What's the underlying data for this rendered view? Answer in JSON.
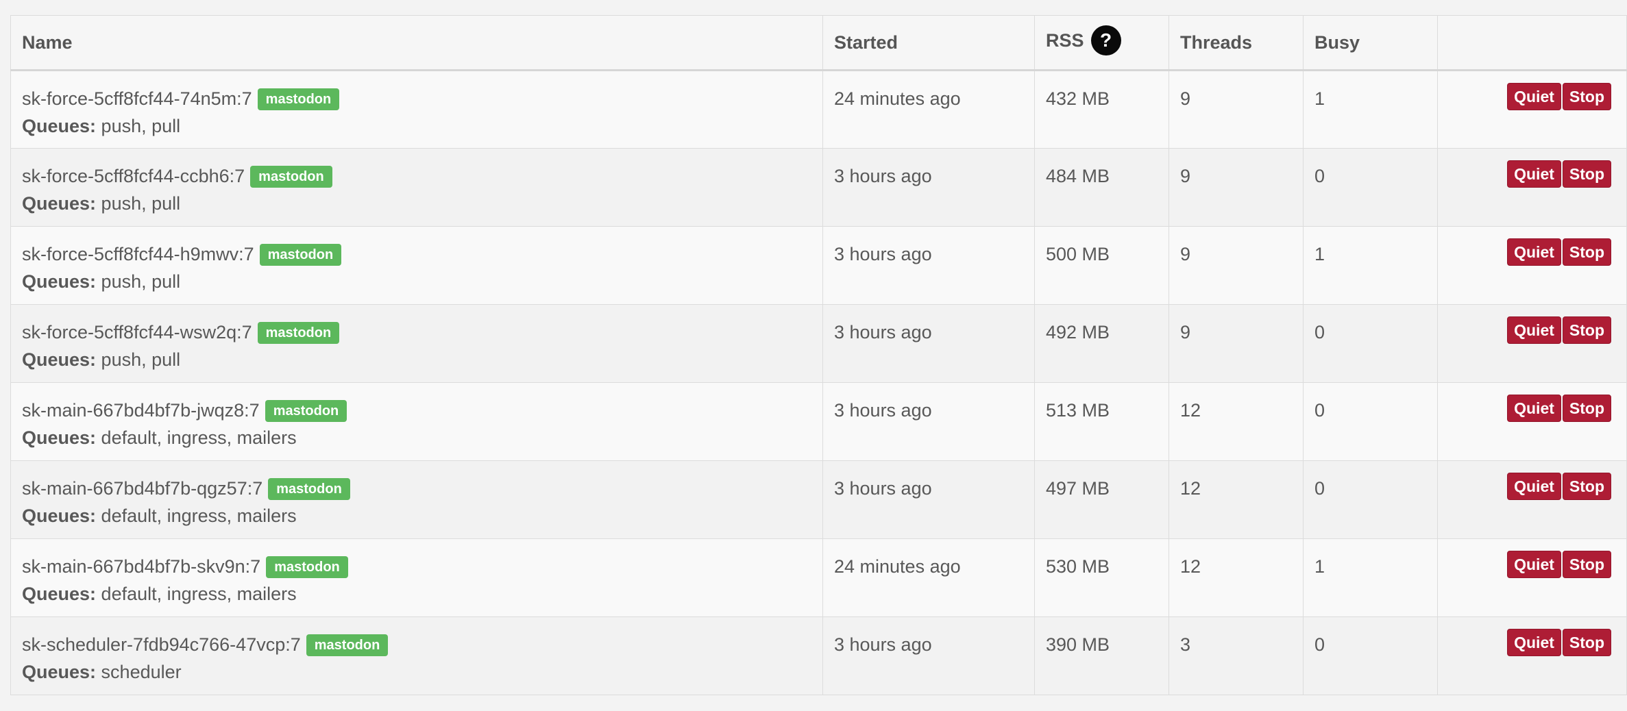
{
  "headers": {
    "name": "Name",
    "started": "Started",
    "rss": "RSS",
    "rss_help": "?",
    "threads": "Threads",
    "busy": "Busy",
    "actions": ""
  },
  "labels": {
    "queues": "Queues:",
    "quiet": "Quiet",
    "stop": "Stop"
  },
  "colors": {
    "tag_green": "#5cb85c",
    "button_red": "#ae1d35"
  },
  "processes": [
    {
      "name": "sk-force-5cff8fcf44-74n5m:7",
      "tag": "mastodon",
      "queues": "push, pull",
      "started": "24 minutes ago",
      "rss": "432 MB",
      "threads": "9",
      "busy": "1"
    },
    {
      "name": "sk-force-5cff8fcf44-ccbh6:7",
      "tag": "mastodon",
      "queues": "push, pull",
      "started": "3 hours ago",
      "rss": "484 MB",
      "threads": "9",
      "busy": "0"
    },
    {
      "name": "sk-force-5cff8fcf44-h9mwv:7",
      "tag": "mastodon",
      "queues": "push, pull",
      "started": "3 hours ago",
      "rss": "500 MB",
      "threads": "9",
      "busy": "1"
    },
    {
      "name": "sk-force-5cff8fcf44-wsw2q:7",
      "tag": "mastodon",
      "queues": "push, pull",
      "started": "3 hours ago",
      "rss": "492 MB",
      "threads": "9",
      "busy": "0"
    },
    {
      "name": "sk-main-667bd4bf7b-jwqz8:7",
      "tag": "mastodon",
      "queues": "default, ingress, mailers",
      "started": "3 hours ago",
      "rss": "513 MB",
      "threads": "12",
      "busy": "0"
    },
    {
      "name": "sk-main-667bd4bf7b-qgz57:7",
      "tag": "mastodon",
      "queues": "default, ingress, mailers",
      "started": "3 hours ago",
      "rss": "497 MB",
      "threads": "12",
      "busy": "0"
    },
    {
      "name": "sk-main-667bd4bf7b-skv9n:7",
      "tag": "mastodon",
      "queues": "default, ingress, mailers",
      "started": "24 minutes ago",
      "rss": "530 MB",
      "threads": "12",
      "busy": "1"
    },
    {
      "name": "sk-scheduler-7fdb94c766-47vcp:7",
      "tag": "mastodon",
      "queues": "scheduler",
      "started": "3 hours ago",
      "rss": "390 MB",
      "threads": "3",
      "busy": "0"
    }
  ]
}
